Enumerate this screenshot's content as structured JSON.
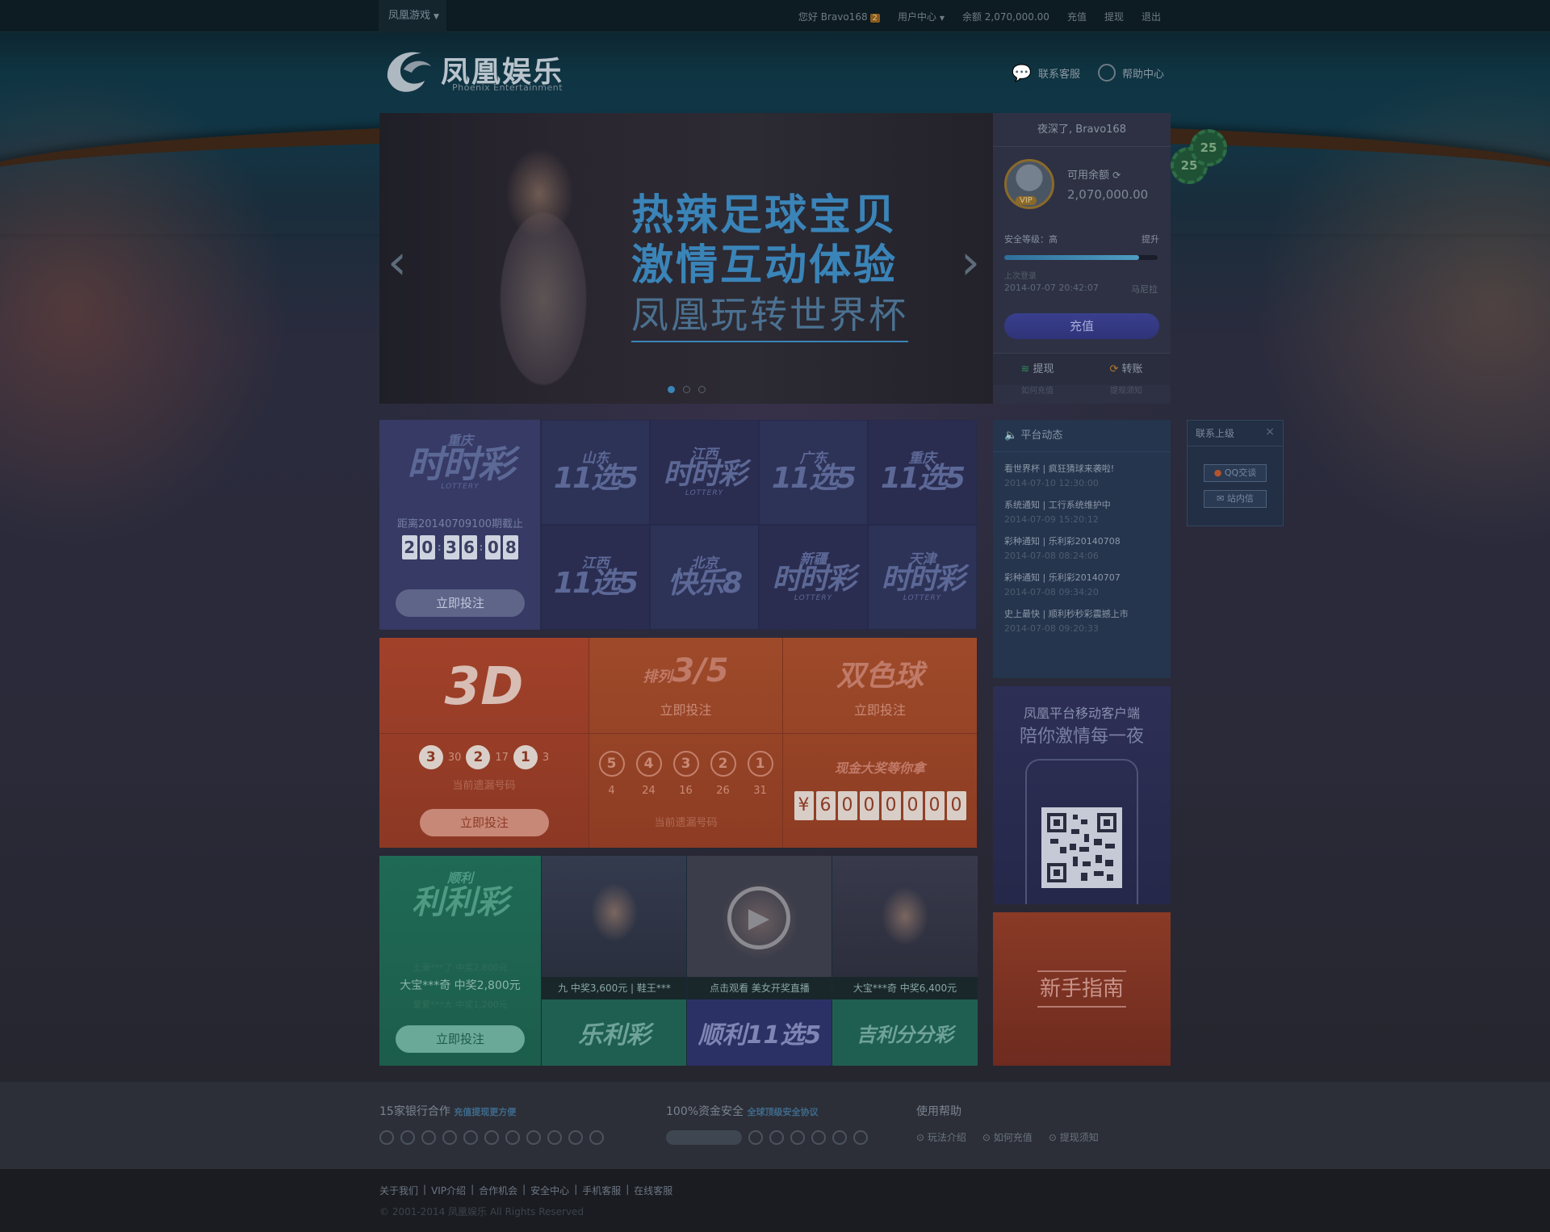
{
  "topbar": {
    "game_menu": "凤凰游戏",
    "greeting": "您好 Bravo168",
    "msg_count": "2",
    "user_center": "用户中心",
    "balance": "余额 2,070,000.00",
    "recharge": "充值",
    "withdraw": "提现",
    "logout": "退出"
  },
  "brand": {
    "name_cn": "凤凰娱乐",
    "name_en": "Phoenix Entertainment"
  },
  "header": {
    "support": "联系客服",
    "help": "帮助中心"
  },
  "banner": {
    "line1": "热辣足球宝贝",
    "line2": "激情互动体验",
    "line3": "凤凰玩转世界杯",
    "active_dot": 1,
    "dot_count": 3
  },
  "user": {
    "greeting": "夜深了, Bravo168",
    "balance_label": "可用余额",
    "balance": "2,070,000.00",
    "vip": "VIP",
    "security_label": "安全等级：高",
    "security_up": "提升",
    "security_level": 0.88,
    "last_login_label": "上次登录",
    "last_login_time": "2014-07-07 20:42:07",
    "last_login_place": "马尼拉",
    "recharge_btn": "充值",
    "withdraw": "提现",
    "transfer": "转账",
    "how_recharge": "如何充值",
    "withdraw_notice": "提现须知"
  },
  "chips": [
    "25",
    "25"
  ],
  "lottery": {
    "feature": {
      "top": "重庆",
      "name": "时时彩",
      "sub": "LOTTERY",
      "deadline": "距离20140709100期截止",
      "digits": [
        "2",
        "0",
        "3",
        "6",
        "0",
        "8"
      ],
      "button": "立即投注"
    },
    "games": [
      {
        "top": "山东",
        "name": "11选5"
      },
      {
        "top": "江西",
        "name": "时时彩",
        "sub": "LOTTERY"
      },
      {
        "top": "广东",
        "name": "11选5"
      },
      {
        "top": "重庆",
        "name": "11选5"
      },
      {
        "top": "江西",
        "name": "11选5"
      },
      {
        "top": "北京",
        "name": "快乐8"
      },
      {
        "top": "新疆",
        "name": "时时彩",
        "sub": "LOTTERY"
      },
      {
        "top": "天津",
        "name": "时时彩",
        "sub": "LOTTERY"
      }
    ]
  },
  "g3d": {
    "title": "3D",
    "balls": [
      {
        "n": "3",
        "c": "30"
      },
      {
        "n": "2",
        "c": "17"
      },
      {
        "n": "1",
        "c": "3"
      }
    ],
    "caption": "当前遗漏号码",
    "button": "立即投注"
  },
  "pl35": {
    "title_small": "排列",
    "title": "3/5",
    "join": "立即投注",
    "balls": [
      "5",
      "4",
      "3",
      "2",
      "1"
    ],
    "counts": [
      "4",
      "24",
      "16",
      "26",
      "31"
    ],
    "caption": "当前遗漏号码"
  },
  "ssq": {
    "title": "双色球",
    "join": "立即投注",
    "jackpot_label": "现金大奖等你拿",
    "jackpot_digits": [
      "¥",
      "6",
      "0",
      "0",
      "0",
      "0",
      "0",
      "0"
    ]
  },
  "shunli": {
    "small": "顺利",
    "title": "利利彩",
    "line1": "土豪***了 中奖2,800元",
    "line2": "大宝***奇  中奖2,800元",
    "line3": "爱爱***大  中奖1,200元",
    "button": "立即投注"
  },
  "promos": [
    {
      "caption": "九 中奖3,600元 | 鞋王***",
      "game": "乐利彩"
    },
    {
      "caption": "点击观看 美女开奖直播",
      "game": "顺利11选5"
    },
    {
      "caption": "大宝***奇  中奖6,400元",
      "game": "吉利分分彩"
    }
  ],
  "news": {
    "title": "平台动态",
    "items": [
      {
        "t": "看世界杯 | 疯狂猜球来袭啦!",
        "d": "2014-07-10 12:30:00"
      },
      {
        "t": "系统通知 | 工行系统维护中",
        "d": "2014-07-09 15:20:12"
      },
      {
        "t": "彩种通知 | 乐利彩20140708",
        "d": "2014-07-08 08:24:06"
      },
      {
        "t": "彩种通知 | 乐利彩20140707",
        "d": "2014-07-08 09:34:20"
      },
      {
        "t": "史上最快 | 顺利秒秒彩震撼上市",
        "d": "2014-07-08 09:20:33"
      }
    ]
  },
  "mobile": {
    "line1": "凤凰平台移动客户端",
    "line2": "陪你激情每一夜"
  },
  "guide": {
    "title": "新手指南"
  },
  "contact": {
    "title": "联系上级",
    "close": "×",
    "qq": "QQ交谈",
    "mail": "站内信"
  },
  "ribbon": {
    "banks_title": "15家银行合作",
    "banks_note": "充值提现更方便",
    "safety_title": "100%资金安全",
    "safety_note": "全球顶级安全协议",
    "help_title": "使用帮助",
    "help_links": [
      "玩法介绍",
      "如何充值",
      "提现须知"
    ]
  },
  "footer": {
    "links": [
      "关于我们",
      "VIP介绍",
      "合作机会",
      "安全中心",
      "手机客服",
      "在线客服"
    ],
    "copyright": "© 2001-2014 凤凰娱乐 All Rights Reserved"
  }
}
